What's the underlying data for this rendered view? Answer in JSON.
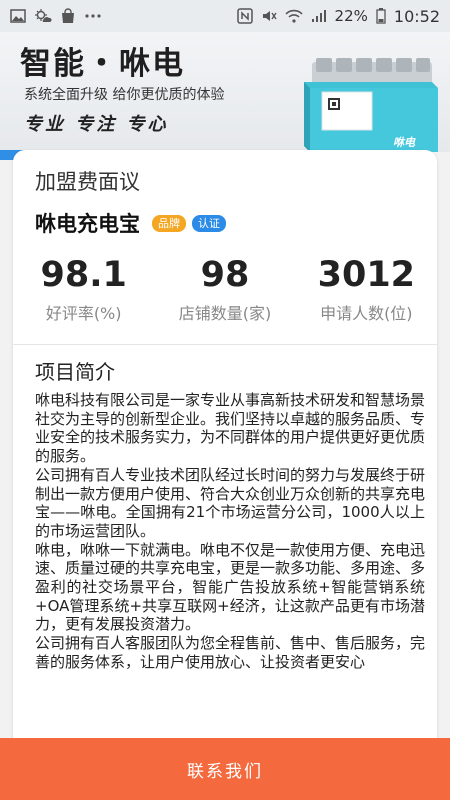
{
  "status_bar": {
    "battery_percent": "22%",
    "time": "10:52",
    "left_icons": [
      "image-icon",
      "weather-icon",
      "shopping-bag-icon",
      "more-dots-icon"
    ],
    "right_icons": [
      "nfc-icon",
      "mute-icon",
      "wifi-icon",
      "signal-icon",
      "battery-icon"
    ]
  },
  "banner": {
    "title": "智能・咻电",
    "subtitle": "系统全面升级 给你更优质的体验",
    "tags": "专业 专注 专心",
    "device_logo": "咻电"
  },
  "card": {
    "heading": "加盟费面议",
    "brand_name": "咻电充电宝",
    "badges": [
      "品牌",
      "认证"
    ],
    "stats": [
      {
        "value": "98.1",
        "label": "好评率(%)"
      },
      {
        "value": "98",
        "label": "店铺数量(家)"
      },
      {
        "value": "3012",
        "label": "申请人数(位)"
      }
    ],
    "intro_heading": "项目简介",
    "intro_paragraphs": [
      "咻电科技有限公司是一家专业从事高新技术研发和智慧场景社交为主导的创新型企业。我们坚持以卓越的服务品质、专业安全的技术服务实力，为不同群体的用户提供更好更优质的服务。",
      "公司拥有百人专业技术团队经过长时间的努力与发展终于研制出一款方便用户使用、符合大众创业万众创新的共享充电宝——咻电。全国拥有21个市场运营分公司，1000人以上的市场运营团队。",
      "咻电，咻咻一下就满电。咻电不仅是一款使用方便、充电迅速、质量过硬的共享充电宝，更是一款多功能、多用途、多盈利的社交场景平台，智能广告投放系统+智能营销系统+OA管理系统+共享互联网+经济，让这款产品更有市场潜力，更有发展投资潜力。",
      "公司拥有百人客服团队为您全程售前、售中、售后服务，完善的服务体系，让用户使用放心、让投资者更安心"
    ]
  },
  "contact_button": "联系我们",
  "colors": {
    "accent": "#f46a3e",
    "badge_brand": "#f5a623",
    "badge_cert": "#2b8be6",
    "device_teal": "#3fc1d6"
  }
}
